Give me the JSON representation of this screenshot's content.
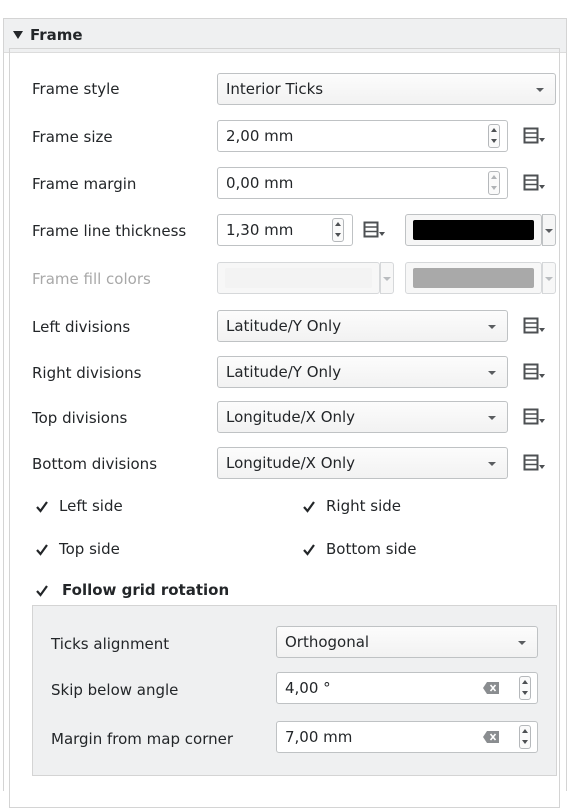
{
  "panel": {
    "title": "Frame"
  },
  "frame_style": {
    "label": "Frame style",
    "value": "Interior Ticks"
  },
  "frame_size": {
    "label": "Frame size",
    "value": "2,00 mm"
  },
  "frame_margin": {
    "label": "Frame margin",
    "value": "0,00 mm"
  },
  "frame_line_thickness": {
    "label": "Frame line thickness",
    "value": "1,30 mm",
    "color": "#000000"
  },
  "frame_fill_colors": {
    "label": "Frame fill colors",
    "color1": "#f3f3f3",
    "color2": "#a9a9a9"
  },
  "left_divisions": {
    "label": "Left divisions",
    "value": "Latitude/Y Only"
  },
  "right_divisions": {
    "label": "Right divisions",
    "value": "Latitude/Y Only"
  },
  "top_divisions": {
    "label": "Top divisions",
    "value": "Longitude/X Only"
  },
  "bottom_divisions": {
    "label": "Bottom divisions",
    "value": "Longitude/X Only"
  },
  "sides": {
    "left": {
      "label": "Left side",
      "checked": true
    },
    "right": {
      "label": "Right side",
      "checked": true
    },
    "top": {
      "label": "Top side",
      "checked": true
    },
    "bottom": {
      "label": "Bottom side",
      "checked": true
    }
  },
  "follow_grid_rotation": {
    "label": "Follow grid rotation",
    "checked": true,
    "ticks_alignment": {
      "label": "Ticks alignment",
      "value": "Orthogonal"
    },
    "skip_below_angle": {
      "label": "Skip below angle",
      "value": "4,00 °"
    },
    "margin_from_corner": {
      "label": "Margin from map corner",
      "value": "7,00 mm"
    }
  },
  "icons": {
    "data_defined": "data-defined-override-icon",
    "clear": "clear-icon",
    "check": "checkmark-icon",
    "collapse": "triangle-down-icon"
  }
}
